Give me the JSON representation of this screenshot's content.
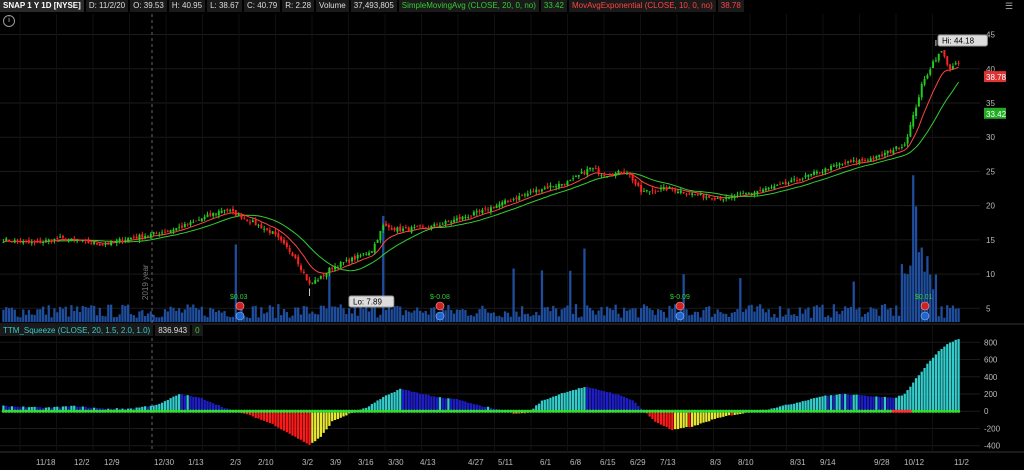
{
  "header": {
    "symbol": "SNAP 1 Y 1D [NYSE]",
    "date": "D: 11/2/20",
    "open": "O: 39.53",
    "high": "H: 40.95",
    "low": "L: 38.67",
    "close": "C: 40.79",
    "range": "R: 2.28",
    "volume_label": "Volume",
    "volume_value": "37,493,805",
    "sma_label": "SimpleMovingAvg (CLOSE, 20, 0, no)",
    "sma_value": "33.42",
    "ema_label": "MovAvgExponential (CLOSE, 10, 0, no)",
    "ema_value": "38.78"
  },
  "squeeze_header": {
    "label": "TTM_Squeeze (CLOSE, 20, 1.5, 2.0, 1.0)",
    "value": "836.943",
    "zero": "0"
  },
  "colors": {
    "up": "#22cc22",
    "down": "#ff2222",
    "sma": "#33cc33",
    "ema": "#ff4444",
    "volume": "#1f4e9e",
    "hist_cyan": "#33cccc",
    "hist_blue": "#1e1ec8",
    "hist_red": "#ff1a1a",
    "hist_yellow": "#e8e833",
    "dot_green": "#33dd33",
    "dot_red": "#ff3333"
  },
  "chart_data": [
    {
      "type": "candlestick",
      "ylim": [
        3,
        48
      ],
      "yticks": [
        5,
        10,
        15,
        20,
        25,
        30,
        35,
        40,
        45
      ],
      "x_labels": [
        "11/18",
        "12/2",
        "12/9",
        "12/30",
        "1/13",
        "2/3",
        "2/10",
        "3/2",
        "3/9",
        "3/16",
        "3/30",
        "4/13",
        "4/27",
        "5/11",
        "6/1",
        "6/8",
        "6/15",
        "6/29",
        "7/13",
        "8/3",
        "8/10",
        "8/31",
        "9/14",
        "9/28",
        "10/12",
        "11/2"
      ],
      "year_marker": "2019 year",
      "annotations": {
        "hi": "Hi: 44.18",
        "lo": "Lo: 7.89"
      },
      "earnings": [
        "$0.03",
        "$-0.08",
        "$-0.09",
        "$0.01"
      ],
      "price_tags": {
        "ema": "38.78",
        "sma": "33.42"
      },
      "series_anchor_points": [
        [
          0,
          15.0
        ],
        [
          10,
          14.5
        ],
        [
          20,
          15.2
        ],
        [
          35,
          14.3
        ],
        [
          45,
          15.3
        ],
        [
          55,
          16.0
        ],
        [
          65,
          17.2
        ],
        [
          78,
          19.5
        ],
        [
          85,
          18.2
        ],
        [
          95,
          16.0
        ],
        [
          103,
          12.5
        ],
        [
          108,
          8.5
        ],
        [
          112,
          9.5
        ],
        [
          116,
          11.0
        ],
        [
          125,
          12.5
        ],
        [
          130,
          13.5
        ],
        [
          134,
          17.0
        ],
        [
          140,
          16.5
        ],
        [
          150,
          16.8
        ],
        [
          160,
          18.0
        ],
        [
          168,
          19.0
        ],
        [
          180,
          21.0
        ],
        [
          190,
          22.5
        ],
        [
          200,
          23.5
        ],
        [
          207,
          25.5
        ],
        [
          212,
          24.5
        ],
        [
          220,
          25.0
        ],
        [
          225,
          22.0
        ],
        [
          235,
          22.5
        ],
        [
          245,
          21.5
        ],
        [
          255,
          21.0
        ],
        [
          265,
          22.0
        ],
        [
          275,
          23.0
        ],
        [
          285,
          24.5
        ],
        [
          295,
          26.0
        ],
        [
          308,
          27.0
        ],
        [
          313,
          28.0
        ],
        [
          318,
          29.0
        ],
        [
          321,
          33.0
        ],
        [
          324,
          37.5
        ],
        [
          328,
          41.0
        ],
        [
          331,
          42.5
        ],
        [
          334,
          40.0
        ],
        [
          337,
          40.79
        ]
      ]
    },
    {
      "type": "bar",
      "title": "TTM_Squeeze",
      "ylim": [
        -450,
        850
      ],
      "yticks": [
        -400,
        -200,
        0,
        200,
        400,
        600,
        800
      ],
      "last_value": 836.943,
      "series_anchor_points": [
        [
          0,
          60
        ],
        [
          15,
          40
        ],
        [
          25,
          60
        ],
        [
          35,
          30
        ],
        [
          45,
          30
        ],
        [
          55,
          80
        ],
        [
          62,
          200
        ],
        [
          70,
          150
        ],
        [
          78,
          40
        ],
        [
          82,
          0
        ],
        [
          88,
          -60
        ],
        [
          95,
          -150
        ],
        [
          102,
          -280
        ],
        [
          108,
          -390
        ],
        [
          112,
          -300
        ],
        [
          116,
          -120
        ],
        [
          122,
          -30
        ],
        [
          128,
          40
        ],
        [
          135,
          180
        ],
        [
          140,
          260
        ],
        [
          148,
          200
        ],
        [
          155,
          150
        ],
        [
          160,
          140
        ],
        [
          166,
          80
        ],
        [
          172,
          40
        ],
        [
          176,
          10
        ],
        [
          180,
          -30
        ],
        [
          185,
          -20
        ],
        [
          190,
          120
        ],
        [
          198,
          220
        ],
        [
          205,
          280
        ],
        [
          210,
          250
        ],
        [
          216,
          200
        ],
        [
          222,
          130
        ],
        [
          226,
          0
        ],
        [
          230,
          -120
        ],
        [
          236,
          -220
        ],
        [
          244,
          -170
        ],
        [
          250,
          -100
        ],
        [
          256,
          -50
        ],
        [
          262,
          -20
        ],
        [
          266,
          0
        ],
        [
          272,
          40
        ],
        [
          280,
          100
        ],
        [
          288,
          170
        ],
        [
          296,
          200
        ],
        [
          304,
          180
        ],
        [
          310,
          170
        ],
        [
          314,
          150
        ],
        [
          318,
          200
        ],
        [
          322,
          380
        ],
        [
          326,
          550
        ],
        [
          330,
          700
        ],
        [
          334,
          800
        ],
        [
          337,
          836.943
        ]
      ]
    }
  ]
}
